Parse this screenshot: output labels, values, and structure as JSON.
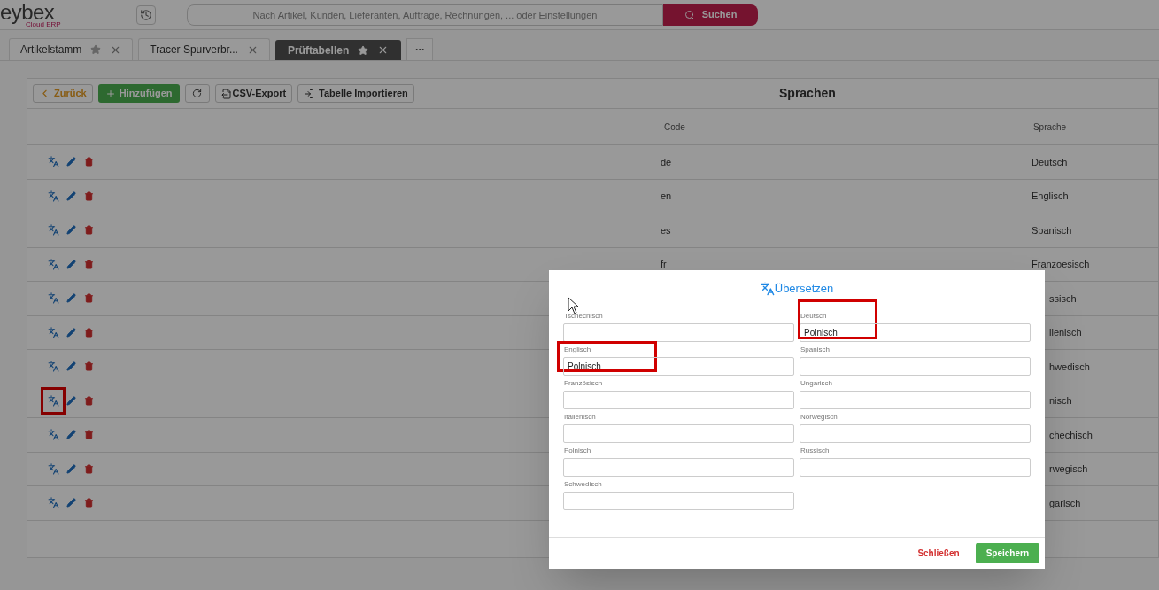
{
  "logo": {
    "name": "eybex",
    "tagline": "Cloud ERP"
  },
  "search": {
    "placeholder": "Nach Artikel, Kunden, Lieferanten, Aufträge, Rechnungen, ... oder Einstellungen",
    "button": "Suchen"
  },
  "tabs": [
    {
      "label": "Artikelstamm",
      "selected": false
    },
    {
      "label": "Tracer Spurverbr...",
      "selected": false
    },
    {
      "label": "Prüftabellen",
      "selected": true
    }
  ],
  "toolbar": {
    "back": "Zurück",
    "add": "Hinzufügen",
    "export": "CSV-Export",
    "import": "Tabelle Importieren",
    "title": "Sprachen"
  },
  "table": {
    "columns": [
      "Code",
      "Sprache"
    ],
    "rows": [
      {
        "code": "de",
        "language": "Deutsch",
        "highlighted": false
      },
      {
        "code": "en",
        "language": "Englisch",
        "highlighted": false
      },
      {
        "code": "es",
        "language": "Spanisch",
        "highlighted": false
      },
      {
        "code": "fr",
        "language": "Franzoesisch",
        "highlighted": false
      },
      {
        "language": "ssisch",
        "clipped": true,
        "highlighted": false
      },
      {
        "language": "lienisch",
        "clipped": true,
        "highlighted": false
      },
      {
        "language": "hwedisch",
        "clipped": true,
        "highlighted": false
      },
      {
        "language": "nisch",
        "clipped": true,
        "highlighted": true
      },
      {
        "language": "chechisch",
        "clipped": true,
        "highlighted": false
      },
      {
        "language": "rwegisch",
        "clipped": true,
        "highlighted": false
      },
      {
        "language": "garisch",
        "clipped": true,
        "highlighted": false
      }
    ]
  },
  "dialog": {
    "title": "Übersetzen",
    "fields": [
      {
        "label": "Tschechisch",
        "highlighted": false
      },
      {
        "label": "Deutsch",
        "value": "Polnisch",
        "highlighted": true
      },
      {
        "label": "Englisch",
        "value": "Polnisch",
        "highlighted": true
      },
      {
        "label": "Spanisch",
        "highlighted": false
      },
      {
        "label": "Französisch",
        "highlighted": false
      },
      {
        "label": "Ungarisch",
        "highlighted": false
      },
      {
        "label": "Italienisch",
        "highlighted": false
      },
      {
        "label": "Norwegisch",
        "highlighted": false
      },
      {
        "label": "Polnisch",
        "highlighted": false
      },
      {
        "label": "Russisch",
        "highlighted": false
      },
      {
        "label": "Schwedisch",
        "highlighted": false
      }
    ],
    "close": "Schließen",
    "save": "Speichern"
  }
}
